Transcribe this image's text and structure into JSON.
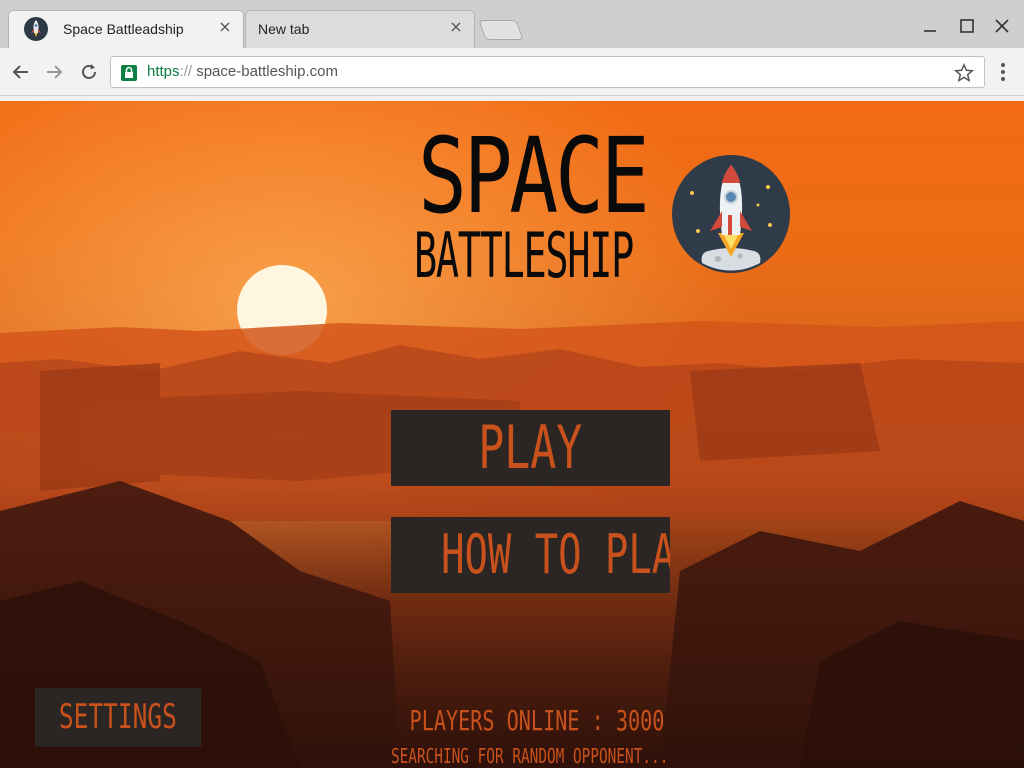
{
  "browser": {
    "tabs": [
      {
        "title": "Space Battleadship",
        "active": true,
        "close": "×"
      },
      {
        "title": "New tab",
        "active": false,
        "close": "×"
      }
    ],
    "url": {
      "scheme": "https",
      "separator": "://",
      "host": " space-battleship.com"
    }
  },
  "game": {
    "logo": {
      "line1": "SPACE",
      "line2": "BATTLESHIP"
    },
    "menu": {
      "play_label": "PLAY",
      "how_to_play_label": "HOW TO PLAY",
      "settings_label": "SETTINGS"
    },
    "status": {
      "players_online": "PLAYERS ONLINE : 3000",
      "searching": "SEARCHING FOR RANDOM OPPONENT..."
    }
  },
  "colors": {
    "sky": "#f26a14",
    "button_bg": "#2b2523",
    "button_text": "#c9521c",
    "logo_text": "#0a0a0a",
    "https_green": "#0b8043"
  },
  "icons": [
    "app-favicon-icon",
    "close-icon",
    "minimize-icon",
    "maximize-icon",
    "back-icon",
    "forward-icon",
    "reload-icon",
    "lock-icon",
    "star-icon",
    "menu-icon",
    "rocket-icon"
  ]
}
